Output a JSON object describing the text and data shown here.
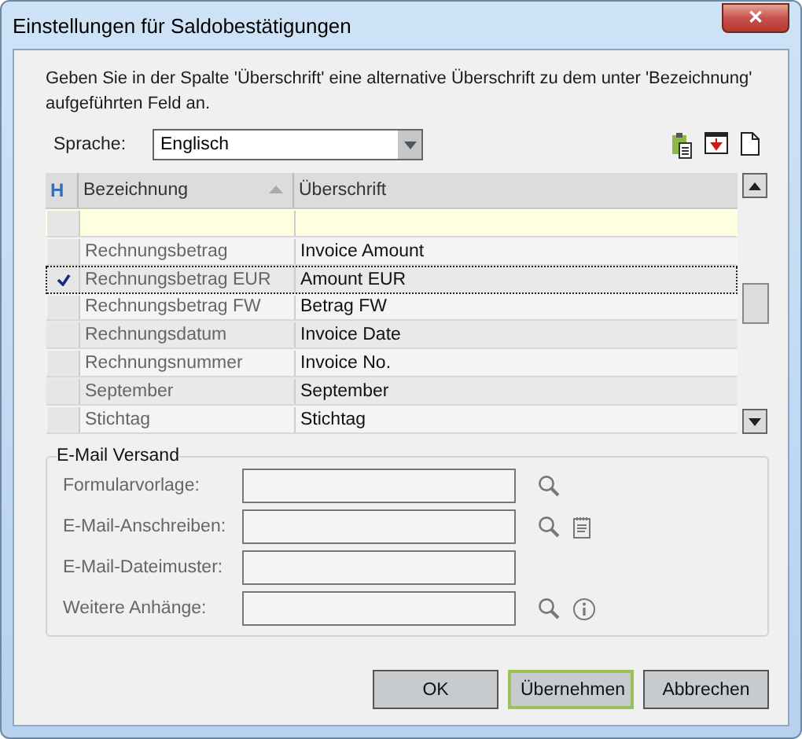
{
  "window": {
    "title": "Einstellungen für Saldobestätigungen",
    "close": "✕"
  },
  "intro": "Geben Sie in der Spalte 'Überschrift' eine alternative Überschrift zu dem unter 'Bezeichnung' aufgeführten Feld an.",
  "language": {
    "label": "Sprache:",
    "value": "Englisch"
  },
  "table": {
    "header_mark": "H",
    "columns": [
      "Bezeichnung",
      "Überschrift"
    ],
    "rows": [
      {
        "kind": "new",
        "name": "",
        "caption": "",
        "selected": false
      },
      {
        "kind": "row",
        "name": "Rechnungsbetrag",
        "caption": "Invoice Amount",
        "selected": false
      },
      {
        "kind": "row",
        "name": "Rechnungsbetrag EUR",
        "caption": "Amount EUR",
        "selected": true
      },
      {
        "kind": "row",
        "name": "Rechnungsbetrag FW",
        "caption": "Betrag FW",
        "selected": false
      },
      {
        "kind": "row",
        "name": "Rechnungsdatum",
        "caption": "Invoice Date",
        "selected": false
      },
      {
        "kind": "row",
        "name": "Rechnungsnummer",
        "caption": "Invoice No.",
        "selected": false
      },
      {
        "kind": "row",
        "name": "September",
        "caption": "September",
        "selected": false
      },
      {
        "kind": "row",
        "name": "Stichtag",
        "caption": "Stichtag",
        "selected": false
      }
    ]
  },
  "email": {
    "title": "E-Mail Versand",
    "fields": [
      {
        "label": "Formularvorlage:",
        "actions": [
          {
            "kind": "search"
          }
        ]
      },
      {
        "label": "E-Mail-Anschreiben:",
        "actions": [
          {
            "kind": "search"
          },
          {
            "kind": "notes"
          }
        ]
      },
      {
        "label": "E-Mail-Dateimuster:"
      },
      {
        "label": "Weitere Anhänge:",
        "actions": [
          {
            "kind": "search"
          },
          {
            "kind": "info"
          }
        ]
      }
    ]
  },
  "buttons": [
    {
      "label": "OK",
      "default": false
    },
    {
      "label": "Übernehmen",
      "default": true
    },
    {
      "label": "Abbrechen",
      "default": false
    }
  ]
}
